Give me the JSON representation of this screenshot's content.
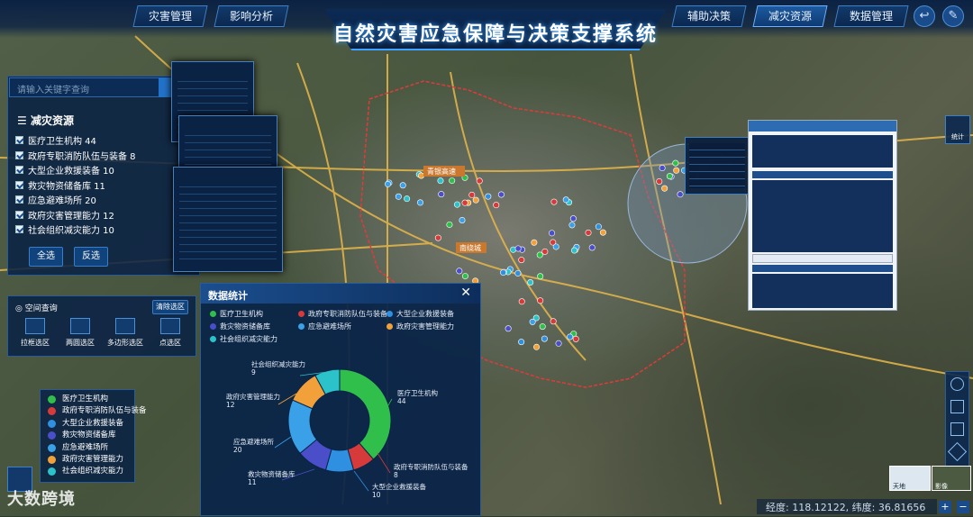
{
  "app": {
    "title": "自然灾害应急保障与决策支撑系统"
  },
  "nav": {
    "left": [
      "灾害管理",
      "影响分析"
    ],
    "right": [
      "辅助决策",
      "减灾资源",
      "数据管理"
    ],
    "active": "减灾资源"
  },
  "search": {
    "placeholder": "请输入关键字查询"
  },
  "resources": {
    "title": "减灾资源",
    "items": [
      {
        "label": "医疗卫生机构 44"
      },
      {
        "label": "政府专职消防队伍与装备 8"
      },
      {
        "label": "大型企业救援装备 10"
      },
      {
        "label": "救灾物资储备库 11"
      },
      {
        "label": "应急避难场所 20"
      },
      {
        "label": "政府灾害管理能力 12"
      },
      {
        "label": "社会组织减灾能力 10"
      }
    ],
    "select_all": "全选",
    "invert": "反选"
  },
  "spatial": {
    "title": "空间查询",
    "clear": "清除选区",
    "tools": [
      "拉框选区",
      "两圆选区",
      "多边形选区",
      "点选区"
    ]
  },
  "map_labels": {
    "marker1": "青银高速",
    "marker2": "南绕城"
  },
  "legend": {
    "items": [
      {
        "label": "医疗卫生机构",
        "color": "#2fbf4a"
      },
      {
        "label": "政府专职消防队伍与装备",
        "color": "#d63a3a"
      },
      {
        "label": "大型企业救援装备",
        "color": "#2f8fe0"
      },
      {
        "label": "救灾物资储备库",
        "color": "#4a4ec8"
      },
      {
        "label": "应急避难场所",
        "color": "#3aa0e8"
      },
      {
        "label": "政府灾害管理能力",
        "color": "#f2a13a"
      },
      {
        "label": "社会组织减灾能力",
        "color": "#2bc3c9"
      }
    ]
  },
  "stats": {
    "title": "数据统计",
    "close": "✕"
  },
  "chart_data": {
    "type": "pie",
    "title": "数据统计",
    "categories": [
      "医疗卫生机构",
      "政府专职消防队伍与装备",
      "大型企业救援装备",
      "救灾物资储备库",
      "应急避难场所",
      "政府灾害管理能力",
      "社会组织减灾能力"
    ],
    "values": [
      44,
      8,
      10,
      11,
      20,
      12,
      9
    ],
    "colors": [
      "#2fbf4a",
      "#d63a3a",
      "#2f8fe0",
      "#4a4ec8",
      "#3aa0e8",
      "#f2a13a",
      "#2bc3c9"
    ],
    "legend": "top",
    "labels": [
      {
        "name": "医疗卫生机构",
        "value": "44"
      },
      {
        "name": "政府专职消防队伍与装备",
        "value": "8"
      },
      {
        "name": "大型企业救援装备",
        "value": "10"
      },
      {
        "name": "救灾物资储备库",
        "value": "11"
      },
      {
        "name": "应急避难场所",
        "value": "20"
      },
      {
        "name": "政府灾害管理能力",
        "value": "12"
      },
      {
        "name": "社会组织减灾能力",
        "value": "9"
      }
    ]
  },
  "sidebar_right": {
    "stats_label": "统计"
  },
  "coords": {
    "text": "经度: 118.12122, 纬度: 36.81656"
  },
  "minimap": {
    "left_label": "天地",
    "right_label": "影像"
  },
  "watermark": "大数跨境"
}
